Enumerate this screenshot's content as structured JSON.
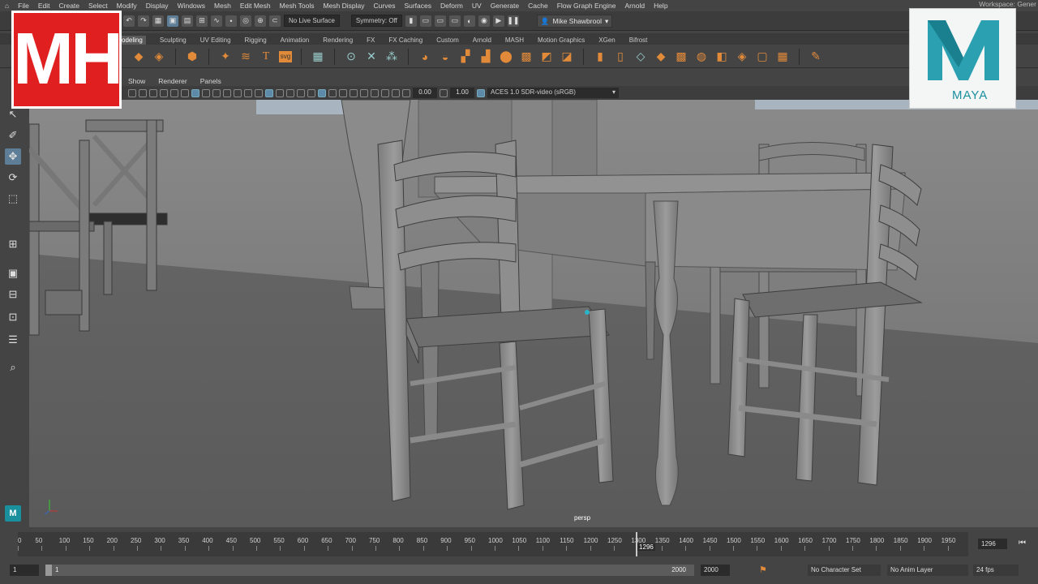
{
  "menubar": {
    "items": [
      "File",
      "Edit",
      "Create",
      "Select",
      "Modify",
      "Display",
      "Windows",
      "Mesh",
      "Edit Mesh",
      "Mesh Tools",
      "Mesh Display",
      "Curves",
      "Surfaces",
      "Deform",
      "UV",
      "Generate",
      "Cache",
      "Flow Graph Engine",
      "Arnold",
      "Help"
    ],
    "workspace": "Workspace: Gener"
  },
  "statusline": {
    "live_surface": "No Live Surface",
    "symmetry": "Symmetry: Off",
    "user": "Mike Shawbrool"
  },
  "shelf_tabs": {
    "active": "odeling",
    "items": [
      "Sculpting",
      "UV Editing",
      "Rigging",
      "Animation",
      "Rendering",
      "FX",
      "FX Caching",
      "Custom",
      "Arnold",
      "MASH",
      "Motion Graphics",
      "XGen",
      "Bifrost"
    ]
  },
  "panel_menu": [
    "Show",
    "Renderer",
    "Panels"
  ],
  "panel_toolbar": {
    "exposure": "0.00",
    "gamma": "1.00",
    "color_space": "ACES 1.0 SDR-video (sRGB)"
  },
  "viewport": {
    "camera": "persp"
  },
  "timeslider": {
    "ticks": [
      "0",
      "50",
      "100",
      "150",
      "200",
      "250",
      "300",
      "350",
      "400",
      "450",
      "500",
      "550",
      "600",
      "650",
      "700",
      "750",
      "800",
      "850",
      "900",
      "950",
      "1000",
      "1050",
      "1100",
      "1150",
      "1200",
      "1250",
      "1300",
      "1350",
      "1400",
      "1450",
      "1500",
      "1550",
      "1600",
      "1650",
      "1700",
      "1750",
      "1800",
      "1850",
      "1900",
      "1950"
    ],
    "current_frame": "1296",
    "current_frame_field": "1296"
  },
  "range": {
    "start": "1",
    "inner_start": "1",
    "inner_end": "2000",
    "end": "2000",
    "character_set": "No Character Set",
    "anim_layer": "No Anim Layer",
    "fps": "24 fps"
  },
  "branding": {
    "mh_text": "MH",
    "maya_text": "MAYA"
  },
  "colors": {
    "brand_red": "#e02020",
    "maya_teal": "#1a8f9e",
    "highlight": "#5d7e96"
  }
}
